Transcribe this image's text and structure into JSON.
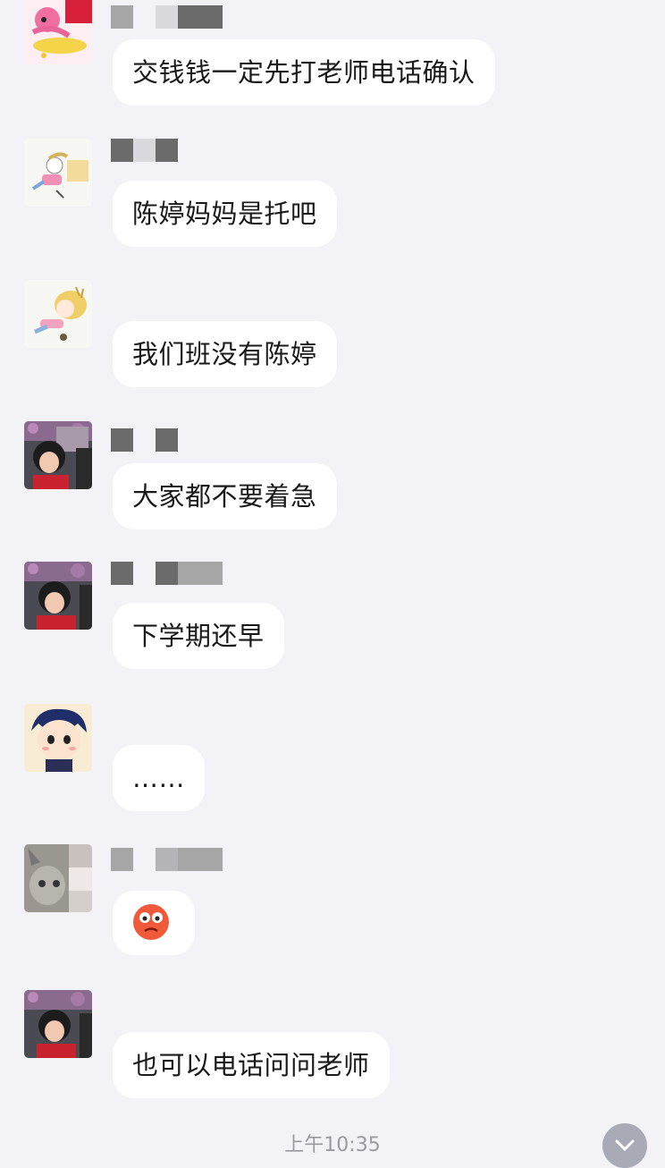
{
  "messages": [
    {
      "text": "交钱钱一定先打老师电话确认",
      "avatar": "cartoon-girl-pink-avatar",
      "name_pixels": [
        "#a6a6a6",
        "#f2f2f7",
        "#d9d9dd",
        "#6b6b6b",
        "#6b6b6b"
      ]
    },
    {
      "text": "陈婷妈妈是托吧",
      "avatar": "cartoon-girl-sleeping-avatar",
      "name_pixels": [
        "#6b6b6b",
        "#d9d9dd",
        "#6b6b6b"
      ]
    },
    {
      "text": "我们班没有陈婷",
      "avatar": "cartoon-girl-blonde-avatar",
      "name_pixels": []
    },
    {
      "text": "大家都不要着急",
      "avatar": "child-photo-avatar",
      "name_pixels": [
        "#6b6b6b",
        "#f2f2f7",
        "#6b6b6b"
      ]
    },
    {
      "text": "下学期还早",
      "avatar": "child-photo-avatar",
      "name_pixels": [
        "#6b6b6b",
        "#f2f2f7",
        "#6b6b6b",
        "#a6a6a6",
        "#a6a6a6"
      ]
    },
    {
      "text": "……",
      "avatar": "cartoon-boy-avatar",
      "name_pixels": []
    },
    {
      "text": "",
      "avatar": "cat-photo-avatar",
      "name_pixels": [
        "#a6a6a6",
        "#f2f2f7",
        "#b4b4b8",
        "#a6a6a6",
        "#a6a6a6"
      ],
      "emoji": "shocked-face-emoji"
    },
    {
      "text": "也可以电话问问老师",
      "avatar": "child-photo-avatar",
      "name_pixels": []
    }
  ],
  "timestamp": "上午10:35",
  "scroll_button_icon": "chevron-down-icon"
}
